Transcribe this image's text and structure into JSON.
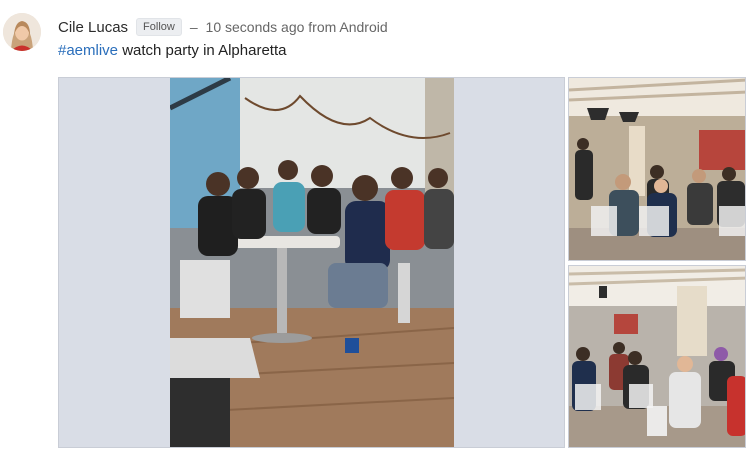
{
  "post": {
    "author": "Cile Lucas",
    "follow_label": "Follow",
    "separator": "–",
    "timestamp": "10 seconds ago from Android",
    "hashtag": "#aemlive",
    "body_text": " watch party in Alpharetta"
  },
  "icons": {
    "avatar": "user-avatar-photo"
  },
  "colors": {
    "hashtag": "#2a6ebb",
    "photo_backdrop": "#d9dde6"
  }
}
